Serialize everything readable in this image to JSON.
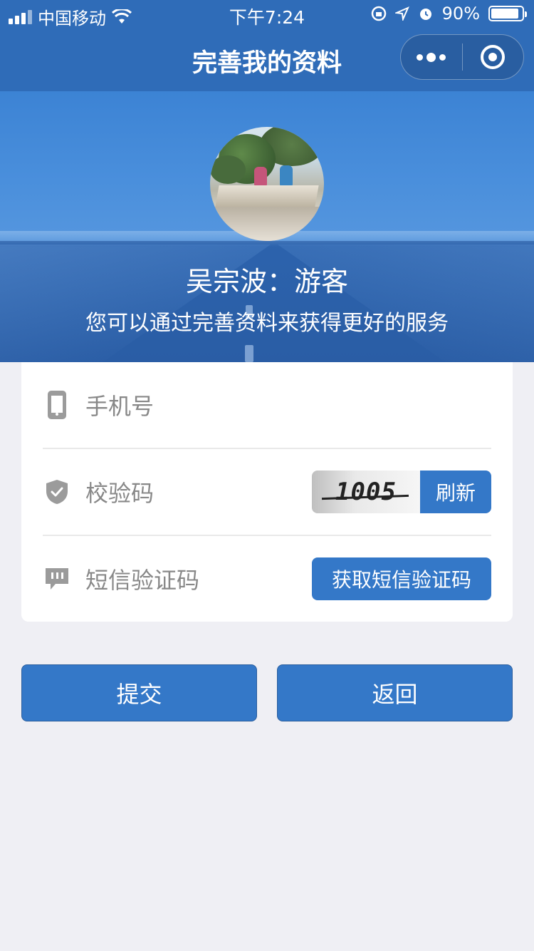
{
  "status_bar": {
    "carrier": "中国移动",
    "time": "下午7:24",
    "battery_percent": "90%",
    "battery_level": 0.9
  },
  "nav": {
    "title": "完善我的资料",
    "more_icon": "more-dots-icon",
    "close_icon": "target-circle-icon"
  },
  "profile": {
    "name": "吴宗波：游客",
    "hint": "您可以通过完善资料来获得更好的服务"
  },
  "form": {
    "phone_placeholder": "手机号",
    "captcha_label": "校验码",
    "captcha_text": "1005",
    "refresh_label": "刷新",
    "sms_label": "短信验证码",
    "sms_button_label": "获取短信验证码"
  },
  "actions": {
    "submit_label": "提交",
    "back_label": "返回"
  },
  "colors": {
    "primary": "#3478c8",
    "nav_background": "#2f6cb8",
    "page_background": "#efeff4",
    "icon_gray": "#9b9b9b"
  }
}
